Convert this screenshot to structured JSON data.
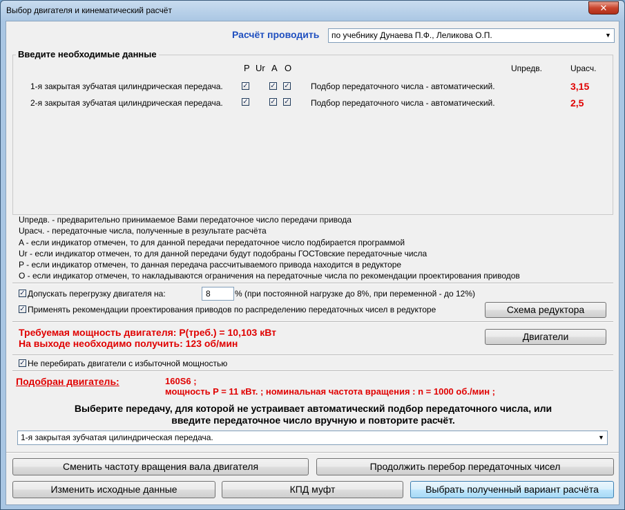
{
  "window": {
    "title": "Выбор двигателя и кинематический расчёт",
    "close": "✕"
  },
  "calc": {
    "label": "Расчёт проводить",
    "selected": "по учебнику Дунаева П.Ф., Леликова О.П."
  },
  "input_group": {
    "title": "Введите необходимые данные",
    "col_p": "P",
    "col_ur": "Ur",
    "col_a": "A",
    "col_o": "O",
    "col_upred": "Uпредв.",
    "col_urasch": "Uрасч.",
    "rows": [
      {
        "name": "1-я закрытая зубчатая цилиндрическая передача.",
        "p": true,
        "a": true,
        "o": true,
        "mode": "Подбор передаточного числа - автоматический.",
        "urasch": "3,15"
      },
      {
        "name": "2-я закрытая зубчатая цилиндрическая передача.",
        "p": true,
        "a": true,
        "o": true,
        "mode": "Подбор передаточного числа - автоматический.",
        "urasch": "2,5"
      }
    ]
  },
  "legend": [
    "Uпредв. - предварительно принимаемое Вами передаточное число передачи привода",
    "Uрасч. - передаточные числа, полученные в результате расчёта",
    "A - если индикатор отмечен, то для данной передачи передаточное число подбирается программой",
    "Ur - если индикатор отмечен, то для данной передачи будут подобраны ГОСТовские передаточные числа",
    "P - если индикатор отмечен, то данная передача рассчитываемого привода находится в редукторе",
    "O - если индикатор отмечен, то накладываются ограничения на передаточные числа по рекомендации проектирования приводов"
  ],
  "overload": {
    "label": "Допускать перегрузку двигателя на:",
    "value": "8",
    "note": "% (при постоянной нагрузке до 8%, при переменной - до 12%)"
  },
  "recommend": {
    "label": "Применять рекомендации проектирования приводов по распределению передаточных чисел в редукторе"
  },
  "buttons": {
    "scheme": "Схема редуктора",
    "motors": "Двигатели",
    "change_speed": "Сменить частоту вращения вала двигателя",
    "continue": "Продолжить перебор передаточных чисел",
    "change_input": "Изменить исходные данные",
    "kpd": "КПД муфт",
    "choose": "Выбрать полученный вариант расчёта"
  },
  "result": {
    "power": "Требуемая мощность двигателя: P(треб.) = 10,103 кВт",
    "speed": "На выходе необходимо получить:  123 об/мин"
  },
  "no_excess": {
    "label": "Не перебирать двигатели с избыточной мощностью"
  },
  "motor": {
    "label": "Подобран двигатель:",
    "model": "160S6 ;",
    "details": "мощность P = 11 кВт. ;  номинальная частота вращения : n = 1000 об./мин ;"
  },
  "prompt": {
    "line1": "Выберите передачу, для которой не устраивает автоматический подбор передаточного числа, или",
    "line2": "введите передаточное число вручную и повторите расчёт.",
    "selected": "1-я закрытая зубчатая цилиндрическая передача."
  },
  "icons": {
    "check": "✓",
    "dropdown": "▼"
  },
  "colors": {
    "accent_blue": "#1f4fbf",
    "result_red": "#e00000",
    "client_bg": "#f0f0f0"
  }
}
